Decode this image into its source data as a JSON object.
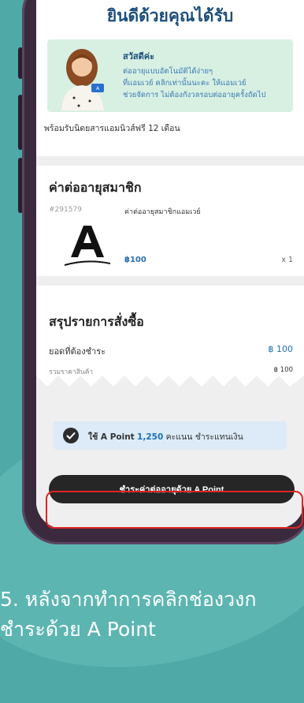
{
  "screen": {
    "title": "ยินดีด้วยคุณได้รับ",
    "banner": {
      "greeting": "สวัสดีค่ะ",
      "lines": [
        "ต่ออายุแบบอัตโนมัติได้ง่ายๆ",
        "ที่แอมเวย์ คลิกเท่านั้นนะคะ ให้แอมเวย์",
        "ช่วยจัดการ ไม่ต้องกังวลรอบต่ออายุครั้งถัดไป"
      ]
    },
    "magazine_text": "พร้อมรับนิตยสารแอมนิวส์ฟรี 12 เดือน",
    "membership": {
      "section_title": "ค่าต่ออายุสมาชิก",
      "order_no": "#291579",
      "item_name": "ค่าต่ออายุสมาชิกแอมเวย์",
      "price": "฿100",
      "qty": "x 1"
    },
    "summary": {
      "section_title": "สรุปรายการสั่งซื้อ",
      "total_label": "ยอดที่ต้องชำระ",
      "total_value": "฿ 100",
      "subtotal_label": "รวมราคาสินค้า",
      "subtotal_value": "฿ 100"
    },
    "apoint": {
      "prefix": "ใช้ A Point",
      "points": "1,250",
      "suffix": "คะแนน ชำระแทนเงิน"
    },
    "pay_button": "ชำระค่าต่ออายุด้วย A Point"
  },
  "caption": {
    "line1": "5. หลังจากทำการคลิกช่องวงก",
    "line2": "ชำระด้วย A Point"
  },
  "colors": {
    "background": "#4fa9a6",
    "accent": "#1d4f7a",
    "highlight": "#e02424"
  }
}
